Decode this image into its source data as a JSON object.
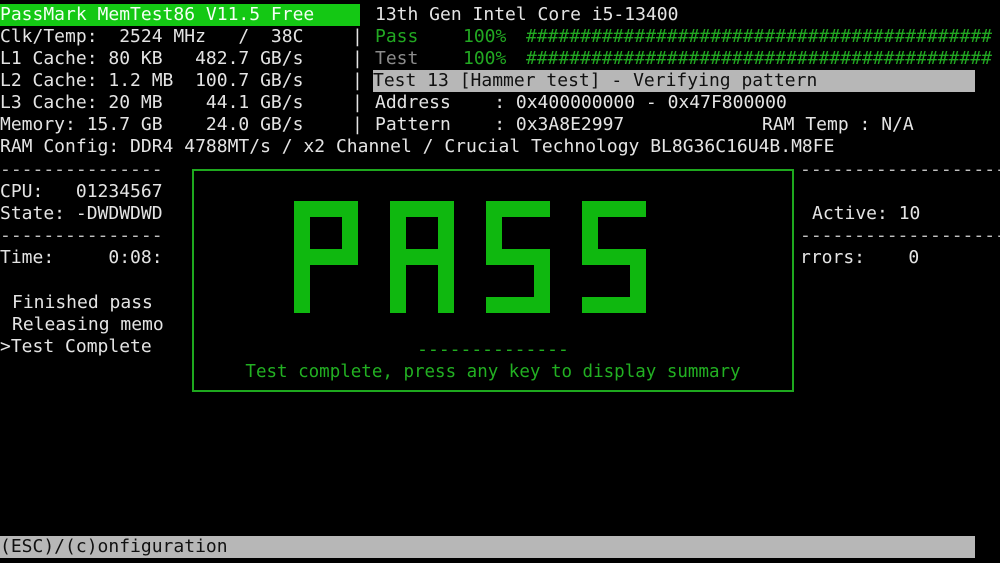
{
  "header": {
    "app_title": "PassMark MemTest86 V11.5 Free",
    "cpu_name": "13th Gen Intel Core i5-13400"
  },
  "system": {
    "clk_temp": "Clk/Temp:  2524 MHz   /  38C",
    "l1": "L1 Cache: 80 KB   482.7 GB/s",
    "l2": "L2 Cache: 1.2 MB  100.7 GB/s",
    "l3": "L3 Cache: 20 MB    44.1 GB/s",
    "memory": "Memory: 15.7 GB    24.0 GB/s",
    "ram_config": "RAM Config: DDR4 4788MT/s / x2 Channel / Crucial Technology BL8G36C16U4B.M8FE"
  },
  "progress": {
    "pass_label": "Pass",
    "pass_pct": "100%",
    "pass_bar": "###########################################",
    "test_label": "Test",
    "test_pct": "100%",
    "test_bar": "###########################################"
  },
  "test": {
    "current": "Test 13 [Hammer test] - Verifying pattern",
    "address": "Address    : 0x400000000 - 0x47F800000",
    "pattern": "Pattern    : 0x3A8E2997",
    "ram_temp": "RAM Temp : N/A"
  },
  "cpu_state": {
    "cpu": "CPU:   01234567",
    "state": "State: -DWDWDWD",
    "active": "Active: 10"
  },
  "timing": {
    "time": "Time:     0:08:",
    "errors": "rrors:    0"
  },
  "log": [
    "Finished pass",
    "Releasing memo",
    ">Test Complete"
  ],
  "dividers": {
    "left": "---------------",
    "right": "----------------------",
    "popup": "--------------"
  },
  "popup": {
    "big_text": "PASS",
    "message": "Test complete, press any key to display summary",
    "color": "#0fb80f"
  },
  "footer": {
    "menu": "(ESC)/(c)onfiguration"
  }
}
